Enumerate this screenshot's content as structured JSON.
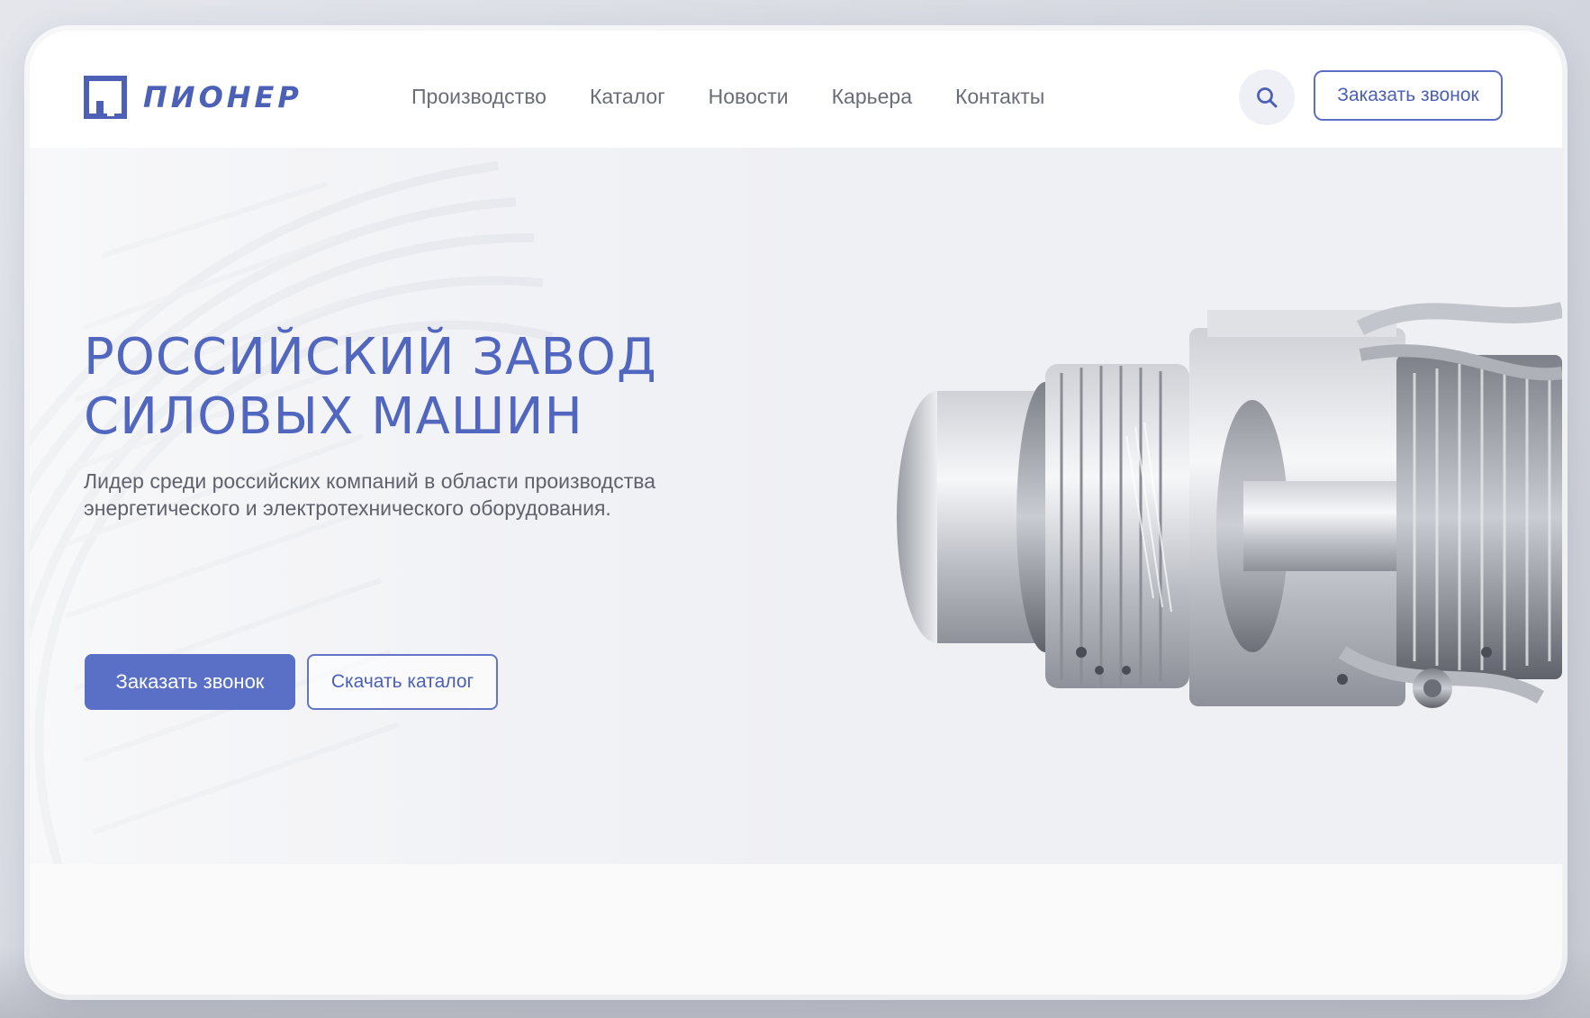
{
  "brand": {
    "name": "ПИОНЕР",
    "color": "#4b60b6",
    "icon": "logo-square-mark"
  },
  "nav": {
    "items": [
      {
        "label": "Производство"
      },
      {
        "label": "Каталог"
      },
      {
        "label": "Новости"
      },
      {
        "label": "Карьера"
      },
      {
        "label": "Контакты"
      }
    ]
  },
  "header": {
    "search_icon": "search-icon",
    "cta_label": "Заказать звонок"
  },
  "hero": {
    "title_line1": "РОССИЙСКИЙ ЗАВОД",
    "title_line2": "СИЛОВЫХ МАШИН",
    "subtitle": "Лидер среди российских компаний в области производства энергетического и электротехнического оборудования.",
    "primary_button": "Заказать звонок",
    "secondary_button": "Скачать каталог",
    "image": "gas-turbine-engine-illustration"
  },
  "colors": {
    "accent": "#5a6fc6",
    "text_muted": "#6a6d78",
    "hero_bg": "#eff0f4"
  }
}
